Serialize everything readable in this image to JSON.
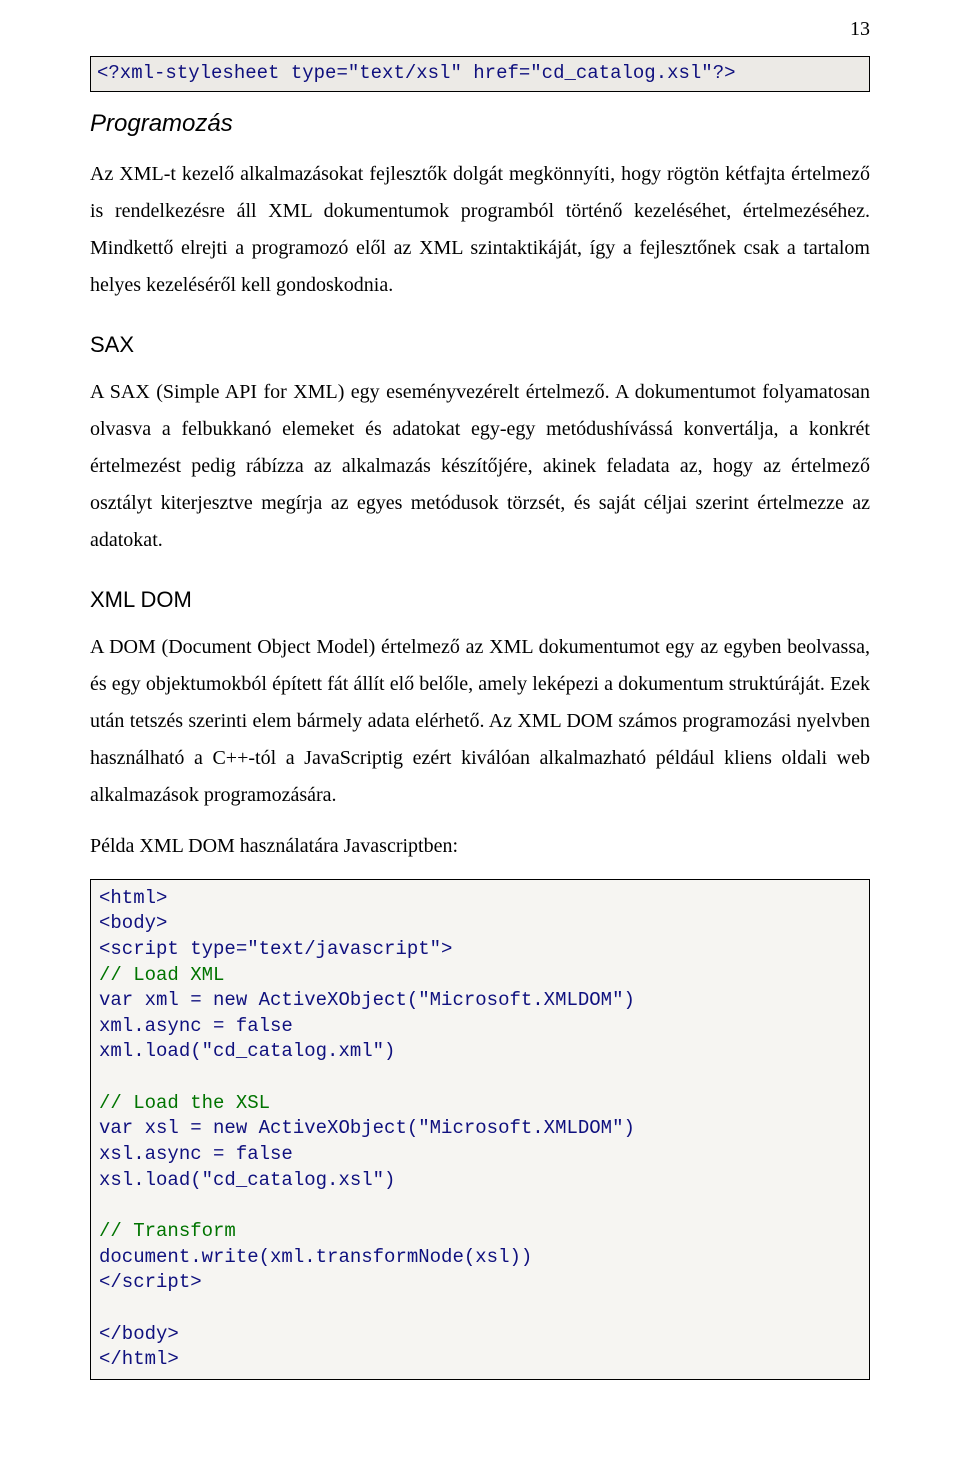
{
  "pageNumber": "13",
  "code1": "<?xml-stylesheet type=\"text/xsl\" href=\"cd_catalog.xsl\"?>",
  "h_prog": "Programozás",
  "p_prog": "Az XML-t kezelő alkalmazásokat fejlesztők dolgát megkönnyíti, hogy rögtön kétfajta értelmező is rendelkezésre áll XML dokumentumok programból történő kezeléséhet, értelmezéséhez. Mindkettő elrejti a programozó elől az XML szintaktikáját, így a fejlesztőnek csak a tartalom helyes kezeléséről kell gondoskodnia.",
  "h_sax": "SAX",
  "p_sax": "A SAX (Simple API for XML) egy eseményvezérelt értelmező. A dokumentumot folyamatosan olvasva a felbukkanó elemeket és adatokat egy-egy metódushívássá konvertálja, a konkrét értelmezést pedig rábízza az alkalmazás készítőjére, akinek feladata az, hogy az értelmező osztályt kiterjesztve megírja az egyes metódusok törzsét, és saját céljai szerint értelmezze az adatokat.",
  "h_dom": "XML DOM",
  "p_dom1": "A DOM (Document Object Model) értelmező az XML dokumentumot egy az egyben beolvassa, és egy objektumokból épített fát állít elő belőle, amely leképezi a dokumentum struktúráját. Ezek után tetszés szerinti elem bármely adata elérhető. Az XML DOM számos programozási nyelvben használható a C++-tól a JavaScriptig ezért kiválóan alkalmazható például kliens oldali web alkalmazások programozására.",
  "p_dom2": "Példa XML DOM használatára Javascriptben:",
  "code2": {
    "l1": "<html>",
    "l2": "<body>",
    "l3": "<script type=\"text/javascript\">",
    "c1": "// Load XML",
    "l4": "var xml = new ActiveXObject(\"Microsoft.XMLDOM\")",
    "l5": "xml.async = false",
    "l6": "xml.load(\"cd_catalog.xml\")",
    "c2": "// Load the XSL",
    "l7": "var xsl = new ActiveXObject(\"Microsoft.XMLDOM\")",
    "l8": "xsl.async = false",
    "l9": "xsl.load(\"cd_catalog.xsl\")",
    "c3": "// Transform",
    "l10": "document.write(xml.transformNode(xsl))",
    "l11": "</script>",
    "l12": "</body>",
    "l13": "</html>"
  }
}
